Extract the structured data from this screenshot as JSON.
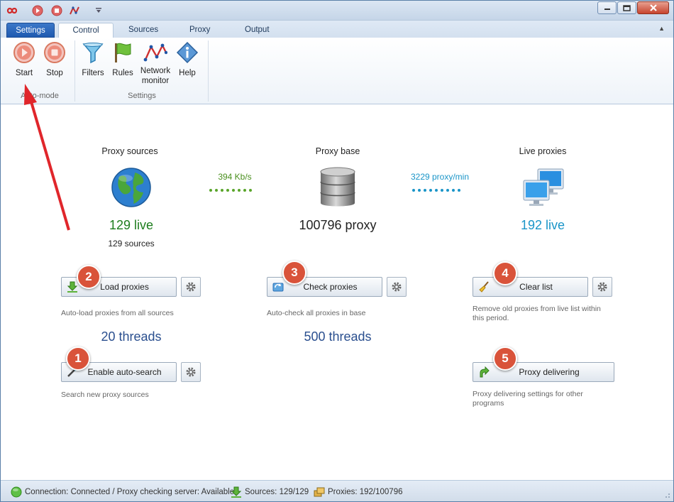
{
  "tabs": {
    "file": "Settings",
    "items": [
      "Control",
      "Sources",
      "Proxy",
      "Output"
    ]
  },
  "ribbon": {
    "start": "Start",
    "stop": "Stop",
    "filters": "Filters",
    "rules": "Rules",
    "network_monitor_line1": "Network",
    "network_monitor_line2": "monitor",
    "help": "Help",
    "group_automode": "Auto-mode",
    "group_settings": "Settings"
  },
  "columns": {
    "sources": {
      "title": "Proxy sources",
      "live": "129 live",
      "sources": "129 sources"
    },
    "base": {
      "title": "Proxy base",
      "count": "100796 proxy"
    },
    "live": {
      "title": "Live proxies",
      "live": "192 live"
    }
  },
  "flow": {
    "download_rate": "394 Kb/s",
    "check_rate": "3229 proxy/min"
  },
  "actions": {
    "load_proxies": {
      "label": "Load proxies",
      "desc": "Auto-load proxies from all sources",
      "threads": "20 threads",
      "step": "2"
    },
    "auto_search": {
      "label": "Enable auto-search",
      "desc": "Search new proxy sources",
      "step": "1"
    },
    "check_proxies": {
      "label": "Check proxies",
      "desc": "Auto-check all proxies in base",
      "threads": "500 threads",
      "step": "3"
    },
    "clear_list": {
      "label": "Clear list",
      "desc_line1": "Remove old proxies from live list within",
      "desc_line2": "this period.",
      "step": "4"
    },
    "proxy_delivering": {
      "label": "Proxy delivering",
      "desc_line1": "Proxy delivering settings for other",
      "desc_line2": "programs",
      "step": "5"
    }
  },
  "status": {
    "connection": "Connection: Connected / Proxy checking server: Available",
    "sources": "Sources: 129/129",
    "proxies": "Proxies: 192/100796"
  },
  "colors": {
    "green_stat": "#1e7d1e",
    "blue_stat": "#1a95c8",
    "badge": "#d9533a",
    "annotation_arrow": "#e0262b"
  }
}
